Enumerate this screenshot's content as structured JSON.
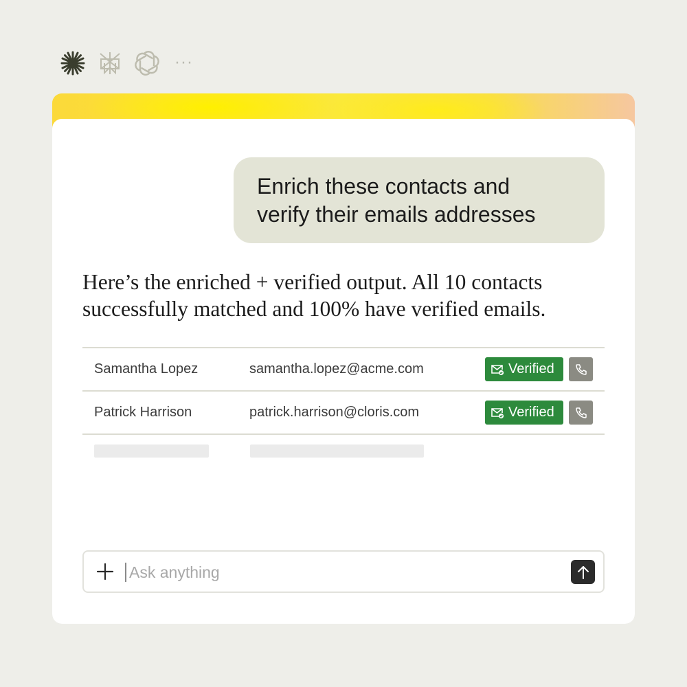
{
  "toolbar": {
    "icons": [
      "asterisk-icon",
      "perplexity-icon",
      "openai-icon",
      "more-icon"
    ],
    "more_label": "···"
  },
  "chat": {
    "user_message_line1": "Enrich these contacts and",
    "user_message_line2": "verify their emails addresses",
    "reply_line1": "Here’s the enriched + verified output. All 10 contacts",
    "reply_line2": "successfully matched and 100% have verified emails."
  },
  "contacts": [
    {
      "name": "Samantha Lopez",
      "email": "samantha.lopez@acme.com",
      "status": "Verified"
    },
    {
      "name": "Patrick Harrison",
      "email": "patrick.harrison@cloris.com",
      "status": "Verified"
    }
  ],
  "composer": {
    "placeholder": "Ask anything"
  },
  "colors": {
    "background": "#eeeee9",
    "user_bubble": "#e3e4d6",
    "verified_badge": "#2d8a3c",
    "phone_button": "#8b8b83",
    "send_button": "#2b2b2b",
    "gradient_start": "#fbd93a",
    "gradient_end": "#f6c7a0"
  }
}
